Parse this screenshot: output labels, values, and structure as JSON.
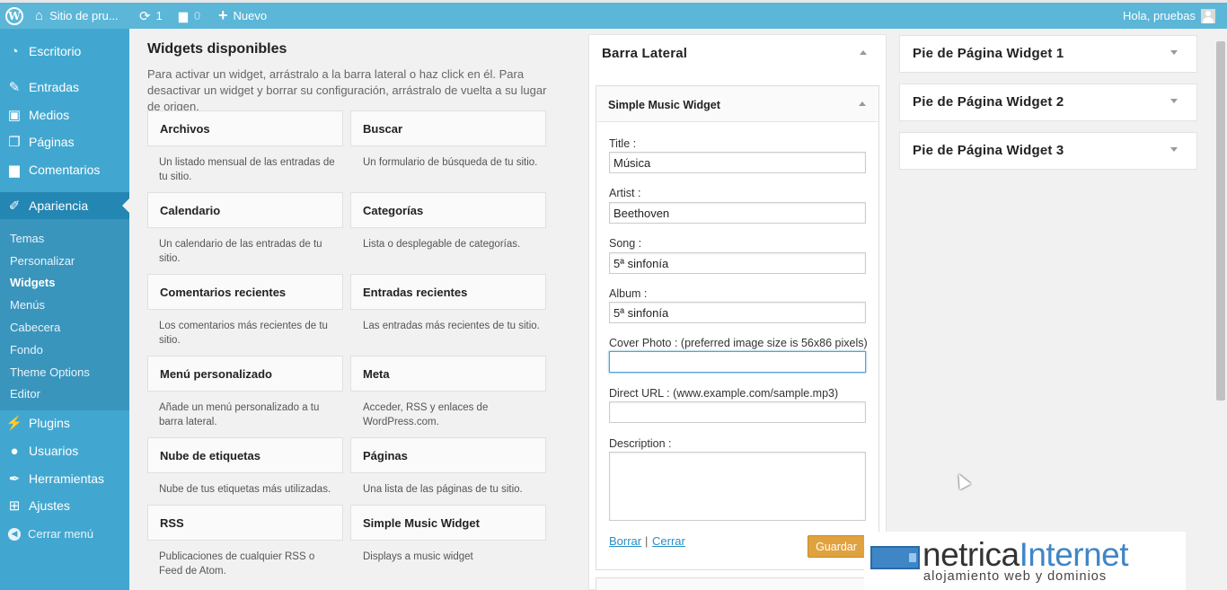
{
  "adminbar": {
    "site_name": "Sitio de pru...",
    "updates_count": "1",
    "comments_count": "0",
    "new_label": "Nuevo",
    "greeting": "Hola, pruebas"
  },
  "menu": {
    "items": [
      {
        "label": "Escritorio",
        "icon": "dashboard-icon"
      },
      {
        "label": "Entradas",
        "icon": "pin-icon"
      },
      {
        "label": "Medios",
        "icon": "media-icon"
      },
      {
        "label": "Páginas",
        "icon": "pages-icon"
      },
      {
        "label": "Comentarios",
        "icon": "comments-icon"
      },
      {
        "label": "Apariencia",
        "icon": "appearance-icon"
      },
      {
        "label": "Plugins",
        "icon": "plugins-icon"
      },
      {
        "label": "Usuarios",
        "icon": "users-icon"
      },
      {
        "label": "Herramientas",
        "icon": "tools-icon"
      },
      {
        "label": "Ajustes",
        "icon": "settings-icon"
      }
    ],
    "submenu": [
      "Temas",
      "Personalizar",
      "Widgets",
      "Menús",
      "Cabecera",
      "Fondo",
      "Theme Options",
      "Editor"
    ],
    "collapse_label": "Cerrar menú"
  },
  "available": {
    "title": "Widgets disponibles",
    "description": "Para activar un widget, arrástralo a la barra lateral o haz click en él. Para desactivar un widget y borrar su configuración, arrástralo de vuelta a su lugar de origen.",
    "widgets": [
      {
        "name": "Archivos",
        "desc": "Un listado mensual de las entradas de tu sitio."
      },
      {
        "name": "Buscar",
        "desc": "Un formulario de búsqueda de tu sitio."
      },
      {
        "name": "Calendario",
        "desc": "Un calendario de las entradas de tu sitio."
      },
      {
        "name": "Categorías",
        "desc": "Lista o desplegable de categorías."
      },
      {
        "name": "Comentarios recientes",
        "desc": "Los comentarios más recientes de tu sitio."
      },
      {
        "name": "Entradas recientes",
        "desc": "Las entradas más recientes de tu sitio."
      },
      {
        "name": "Menú personalizado",
        "desc": "Añade un menú personalizado a tu barra lateral."
      },
      {
        "name": "Meta",
        "desc": "Acceder, RSS y enlaces de WordPress.com."
      },
      {
        "name": "Nube de etiquetas",
        "desc": "Nube de tus etiquetas más utilizadas."
      },
      {
        "name": "Páginas",
        "desc": "Una lista de las páginas de tu sitio."
      },
      {
        "name": "RSS",
        "desc": "Publicaciones de cualquier RSS o Feed de Atom."
      },
      {
        "name": "Simple Music Widget",
        "desc": "Displays a music widget"
      }
    ]
  },
  "sidebar_area": {
    "title": "Barra Lateral",
    "widget": {
      "title": "Simple Music Widget",
      "fields": [
        {
          "label": "Title :",
          "value": "Música"
        },
        {
          "label": "Artist :",
          "value": "Beethoven"
        },
        {
          "label": "Song :",
          "value": "5ª sinfonía"
        },
        {
          "label": "Album :",
          "value": "5ª sinfonía"
        },
        {
          "label": "Cover Photo : (preferred image size is 56x86 pixels)",
          "value": ""
        },
        {
          "label": "Direct URL : (www.example.com/sample.mp3)",
          "value": ""
        }
      ],
      "description_label": "Description :",
      "delete_label": "Borrar",
      "separator": "|",
      "close_label": "Cerrar",
      "save_label": "Guardar"
    }
  },
  "footer_areas": [
    "Pie de Página Widget 1",
    "Pie de Página Widget 2",
    "Pie de Página Widget 3"
  ],
  "logo": {
    "main_a": "netrica",
    "main_b": "Internet",
    "sub": "alojamiento web y dominios"
  },
  "colors": {
    "adminbar": "#5bb6d8",
    "menu": "#42a7d0",
    "menu_current": "#2386b3",
    "save_button": "#e0a23f",
    "link": "#2a8fc4"
  }
}
